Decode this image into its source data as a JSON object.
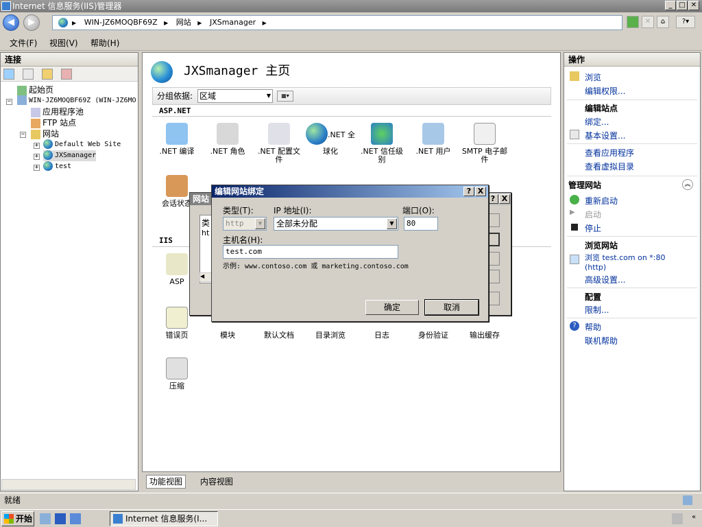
{
  "window": {
    "title": "Internet 信息服务(IIS)管理器"
  },
  "address": {
    "segments": [
      "WIN-JZ6MOQBF69Z",
      "网站",
      "JXSmanager"
    ]
  },
  "menu": {
    "file": "文件(F)",
    "view": "视图(V)",
    "help": "帮助(H)"
  },
  "connections": {
    "title": "连接",
    "tree": {
      "start": "起始页",
      "server": "WIN-JZ6MOQBF69Z (WIN-JZ6MO",
      "app_pools": "应用程序池",
      "ftp": "FTP 站点",
      "sites": "网站",
      "site1": "Default Web Site",
      "site2": "JXSmanager",
      "site3": "test"
    }
  },
  "main": {
    "title": "JXSmanager 主页",
    "group_label": "分组依据:",
    "group_value": "区域",
    "aspnet_section": "ASP.NET",
    "iis_section": "IIS",
    "features_aspnet": [
      ".NET 编译",
      ".NET 角色",
      ".NET 配置文件",
      ".NET 全球化",
      ".NET 信任级别",
      ".NET 用户",
      "SMTP 电子邮件"
    ],
    "session_state": "会话状态",
    "asp": "ASP",
    "features_iis": [
      "错误页",
      "模块",
      "默认文档",
      "目录浏览",
      "日志",
      "身份验证",
      "输出缓存"
    ],
    "compress": "压缩",
    "view_features": "功能视图",
    "view_content": "内容视图"
  },
  "actions": {
    "title": "操作",
    "browse": "浏览",
    "edit_perms": "编辑权限...",
    "edit_site": "编辑站点",
    "bindings": "绑定...",
    "basic_settings": "基本设置...",
    "view_apps": "查看应用程序",
    "view_vdirs": "查看虚拟目录",
    "manage_site": "管理网站",
    "restart": "重新启动",
    "start": "启动",
    "stop": "停止",
    "browse_site": "浏览网站",
    "browse_link": "浏览 test.com on *:80",
    "browse_link2": "(http)",
    "advanced": "高级设置...",
    "config": "配置",
    "limits": "限制...",
    "help": "帮助",
    "online_help": "联机帮助"
  },
  "bg_dialog": {
    "title": "网站",
    "col": "类",
    "cell": "ht"
  },
  "dialog": {
    "title": "编辑网站绑定",
    "type_label": "类型(T):",
    "type_value": "http",
    "ip_label": "IP 地址(I):",
    "ip_value": "全部未分配",
    "port_label": "端口(O):",
    "port_value": "80",
    "host_label": "主机名(H):",
    "host_value": "test.com",
    "example": "示例: www.contoso.com 或 marketing.contoso.com",
    "ok": "确定",
    "cancel": "取消",
    "help_btn": "?",
    "close_btn": "X"
  },
  "status": {
    "text": "就绪"
  },
  "taskbar": {
    "start": "开始",
    "item": "Internet 信息服务(I..."
  },
  "colors": {
    "title_active": "#0a246a",
    "title_active_end": "#a6caf0",
    "link": "#00309c"
  }
}
